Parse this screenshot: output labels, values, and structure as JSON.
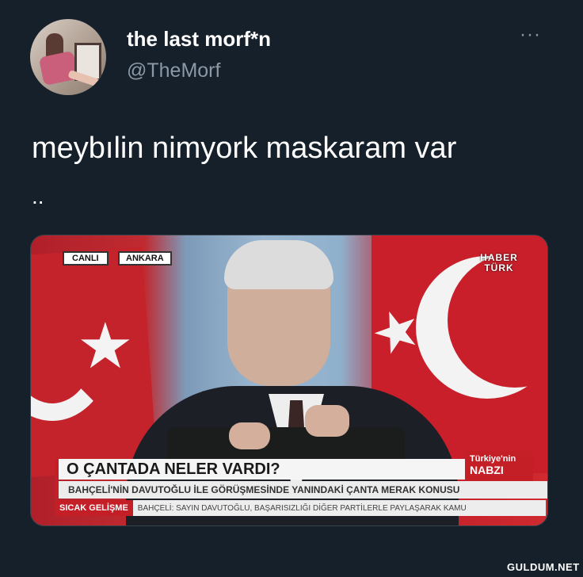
{
  "tweet": {
    "display_name": "the last morf*n",
    "handle": "@TheMorf",
    "more_label": "···",
    "text_line1": "meybılin nimyork maskaram var",
    "text_line2": ".."
  },
  "media": {
    "tag_canli": "CANLI",
    "tag_location": "ANKARA",
    "channel_logo_line1": "HABER",
    "channel_logo_line2": "TÜRK",
    "headline": "O ÇANTADA NELER VARDI?",
    "badge_line1": "Türkiye'nin",
    "badge_line2": "NABZI",
    "subheadline": "BAHÇELİ'NİN DAVUTOĞLU İLE GÖRÜŞMESİNDE YANINDAKİ ÇANTA MERAK KONUSU",
    "ticker_label": "SICAK GELİŞME",
    "ticker_text": "BAHÇELİ: SAYIN DAVUTOĞLU, BAŞARISIZLIĞI DİĞER PARTİLERLE PAYLAŞARAK KAMU"
  },
  "watermark": "GULDUM.NET",
  "colors": {
    "background": "#15202b",
    "secondary_text": "#8b98a5",
    "accent_red": "#c41e27"
  }
}
